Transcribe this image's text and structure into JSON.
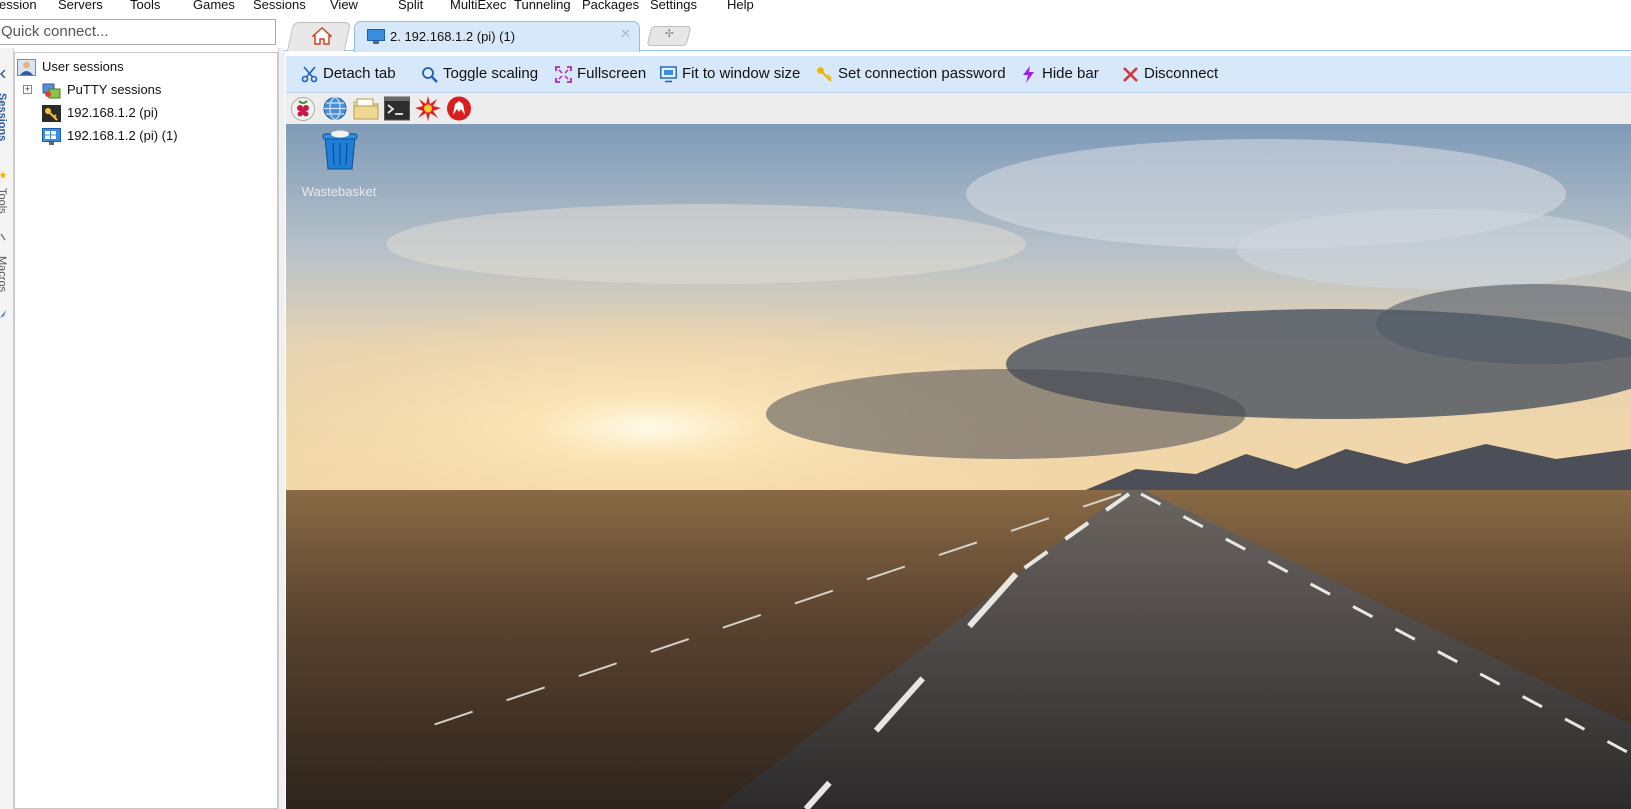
{
  "menu": {
    "items": [
      "ession",
      "Servers",
      "Tools",
      "Games",
      "Sessions",
      "View",
      "Split",
      "MultiExec",
      "Tunneling",
      "Packages",
      "Settings",
      "Help"
    ]
  },
  "quick_connect": {
    "placeholder": "Quick connect..."
  },
  "left_strip": {
    "sessions_label": "Sessions",
    "tools_label": "Tools",
    "macros_label": "Macros"
  },
  "sessions_tree": {
    "root": "User sessions",
    "putty": "PuTTY sessions",
    "items": [
      "192.168.1.2 (pi)",
      "192.168.1.2 (pi) (1)"
    ]
  },
  "tabs": {
    "active_label": "2. 192.168.1.2 (pi) (1)",
    "close_glyph": "✕",
    "new_glyph": "✢"
  },
  "actions": {
    "detach": "Detach tab",
    "toggle_scaling": "Toggle scaling",
    "fullscreen": "Fullscreen",
    "fit": "Fit to window size",
    "password": "Set connection password",
    "hide_bar": "Hide bar",
    "disconnect": "Disconnect"
  },
  "desktop": {
    "wastebasket_label": "Wastebasket",
    "taskbar_icons": [
      "raspberry-menu-icon",
      "web-browser-icon",
      "file-manager-icon",
      "terminal-icon",
      "burst-app-icon",
      "wolfram-icon"
    ]
  },
  "colors": {
    "toolbar_bg": "#d7e8fb",
    "accent": "#2a5aa8",
    "disconnect_red": "#e03030",
    "hide_bar_purple": "#a020f0"
  }
}
